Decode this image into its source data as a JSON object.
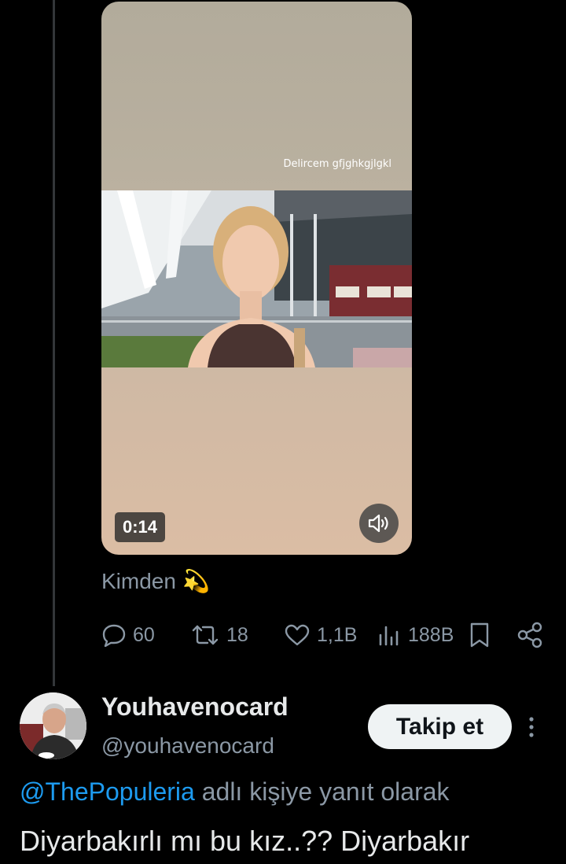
{
  "post": {
    "video": {
      "overlay_text": "Delircem gfjghkgjlgkl",
      "duration": "0:14"
    },
    "caption": "Kimden",
    "caption_emoji": "💫",
    "stats": {
      "replies": "60",
      "reposts": "18",
      "likes": "1,1B",
      "views": "188B"
    }
  },
  "reply": {
    "display_name": "Youhavenocard",
    "handle": "@youhavenocard",
    "follow_label": "Takip et",
    "reply_to_mention": "@ThePopuleria",
    "reply_to_suffix": " adlı kişiye yanıt olarak",
    "text": "Diyarbakırlı mı bu kız..?? Diyarbakır"
  },
  "colors": {
    "background": "#000000",
    "text_primary": "#e7e9ea",
    "text_secondary": "#8b98a5",
    "link": "#1d9bf0",
    "follow_button": "#eff3f4"
  }
}
